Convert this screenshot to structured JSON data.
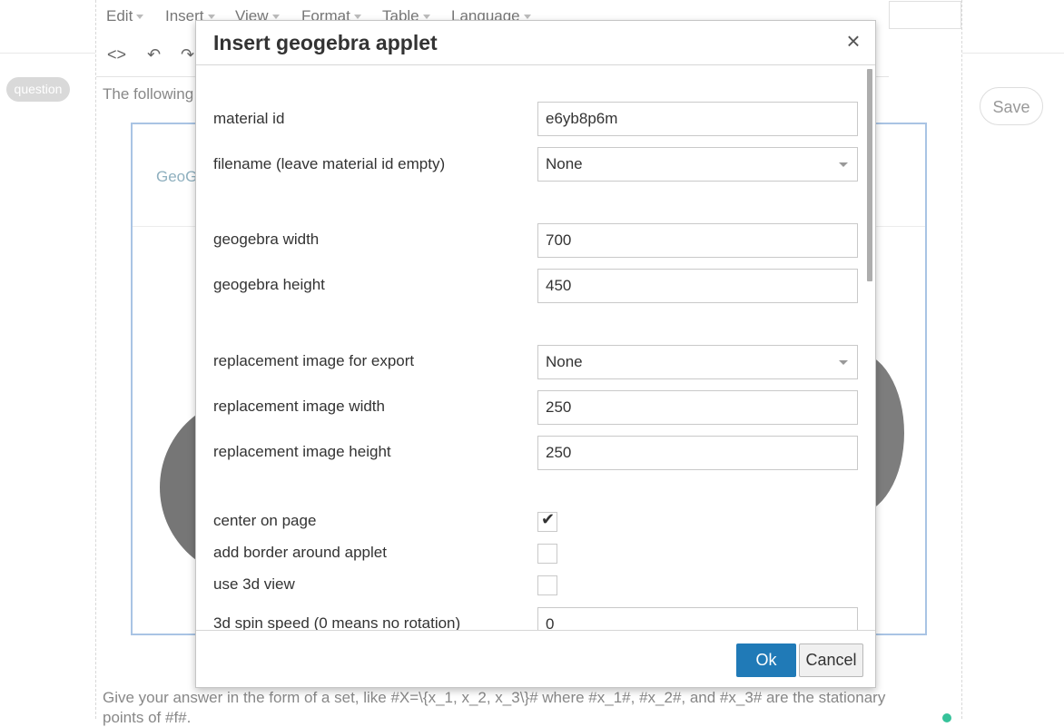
{
  "menubar": {
    "items": [
      {
        "label": "Edit"
      },
      {
        "label": "Insert"
      },
      {
        "label": "View"
      },
      {
        "label": "Format"
      },
      {
        "label": "Table"
      },
      {
        "label": "Language"
      }
    ]
  },
  "toolbar": {
    "source_code_label": "<>"
  },
  "left": {
    "question_label": "question"
  },
  "right": {
    "save_label": "Save"
  },
  "editor": {
    "intro_text": "The following",
    "applet_top_label": "GeoG",
    "answer_text_line1": "Give your answer in the form of a set, like #X=\\{x_1, x_2, x_3\\}# where #x_1#, #x_2#, and #x_3# are the stationary",
    "answer_text_line2": "points of #f#."
  },
  "dialog": {
    "title": "Insert geogebra applet",
    "fields": {
      "material_id": {
        "label": "material id",
        "value": "e6yb8p6m"
      },
      "filename": {
        "label": "filename (leave material id empty)",
        "value": "None"
      },
      "width": {
        "label": "geogebra width",
        "value": "700"
      },
      "height": {
        "label": "geogebra height",
        "value": "450"
      },
      "replacement_image": {
        "label": "replacement image for export",
        "value": "None"
      },
      "replacement_width": {
        "label": "replacement image width",
        "value": "250"
      },
      "replacement_height": {
        "label": "replacement image height",
        "value": "250"
      },
      "center": {
        "label": "center on page",
        "checked": true
      },
      "border": {
        "label": "add border around applet",
        "checked": false
      },
      "use3d": {
        "label": "use 3d view",
        "checked": false
      },
      "spin_speed": {
        "label": "3d spin speed (0 means no rotation)",
        "value": "0"
      }
    },
    "ok_label": "Ok",
    "cancel_label": "Cancel"
  },
  "colors": {
    "accent": "#207ab7",
    "applet_border": "#a9c4e4"
  }
}
